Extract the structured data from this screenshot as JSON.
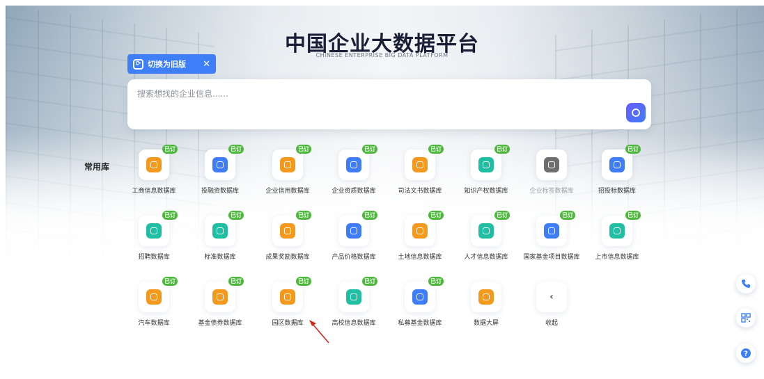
{
  "header": {
    "title": "中国企业大数据平台",
    "subtitle": "CHINESE ENTERPRISE BIG DATA PLATFORM"
  },
  "switch_button": {
    "label": "切换为旧版",
    "close": "✕"
  },
  "search": {
    "placeholder": "搜索想找的企业信息......"
  },
  "section": {
    "label": "常用库"
  },
  "badge_text": "已订",
  "colors": {
    "accent": "#3e7ef7",
    "badge": "#4bb83a",
    "orange": "#f39a1e",
    "blue": "#3f7cf7",
    "teal": "#20bfa4",
    "gray": "#6e6e6e"
  },
  "databases": [
    {
      "label": "工商信息数据库",
      "icon": "business-info-icon",
      "color": "orange",
      "subscribed": true
    },
    {
      "label": "投融资数据库",
      "icon": "investment-icon",
      "color": "blue",
      "subscribed": true
    },
    {
      "label": "企业信用数据库",
      "icon": "credit-icon",
      "color": "orange",
      "subscribed": true
    },
    {
      "label": "企业资质数据库",
      "icon": "qualification-icon",
      "color": "blue",
      "subscribed": true
    },
    {
      "label": "司法文书数据库",
      "icon": "judicial-icon",
      "color": "orange",
      "subscribed": true
    },
    {
      "label": "知识产权数据库",
      "icon": "ip-icon",
      "color": "teal",
      "subscribed": true
    },
    {
      "label": "企业标签数据库",
      "icon": "tag-icon",
      "color": "gray",
      "subscribed": false,
      "disabled": true
    },
    {
      "label": "招投标数据库",
      "icon": "bidding-icon",
      "color": "blue",
      "subscribed": true
    },
    {
      "label": "招聘数据库",
      "icon": "recruit-icon",
      "color": "teal",
      "subscribed": true
    },
    {
      "label": "标准数据库",
      "icon": "standard-icon",
      "color": "teal",
      "subscribed": true
    },
    {
      "label": "成果奖励数据库",
      "icon": "award-icon",
      "color": "orange",
      "subscribed": true
    },
    {
      "label": "产品价格数据库",
      "icon": "price-icon",
      "color": "blue",
      "subscribed": true
    },
    {
      "label": "土地信息数据库",
      "icon": "land-icon",
      "color": "orange",
      "subscribed": true
    },
    {
      "label": "人才信息数据库",
      "icon": "talent-icon",
      "color": "teal",
      "subscribed": true
    },
    {
      "label": "国家基金项目数据库",
      "icon": "fund-project-icon",
      "color": "blue",
      "subscribed": true
    },
    {
      "label": "上市信息数据库",
      "icon": "listed-icon",
      "color": "teal",
      "subscribed": true
    },
    {
      "label": "汽车数据库",
      "icon": "car-icon",
      "color": "orange",
      "subscribed": true
    },
    {
      "label": "基金债券数据库",
      "icon": "bond-icon",
      "color": "orange",
      "subscribed": true
    },
    {
      "label": "园区数据库",
      "icon": "park-icon",
      "color": "orange",
      "subscribed": true
    },
    {
      "label": "高校信息数据库",
      "icon": "university-icon",
      "color": "teal",
      "subscribed": true
    },
    {
      "label": "私募基金数据库",
      "icon": "private-fund-icon",
      "color": "blue",
      "subscribed": true
    },
    {
      "label": "数据大屏",
      "icon": "dashboard-icon",
      "color": "orange",
      "subscribed": false
    }
  ],
  "collapse": {
    "label": "收起",
    "icon": "chevron-left-icon"
  },
  "float_buttons": [
    {
      "name": "phone-icon"
    },
    {
      "name": "qrcode-icon"
    },
    {
      "name": "help-icon"
    }
  ]
}
